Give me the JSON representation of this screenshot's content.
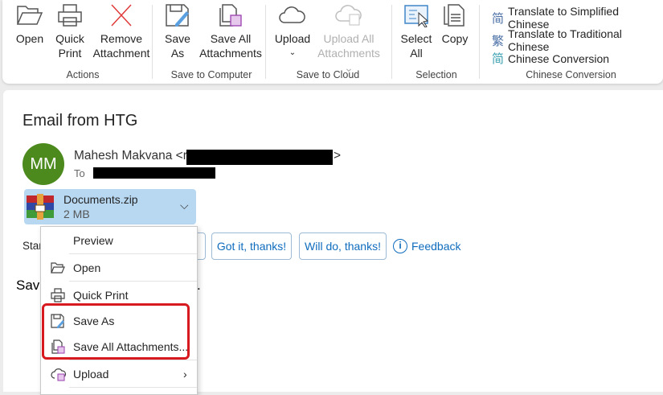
{
  "ribbon": {
    "open": "Open",
    "quick_print_1": "Quick",
    "quick_print_2": "Print",
    "remove_1": "Remove",
    "remove_2": "Attachment",
    "save_as_1": "Save",
    "save_as_2": "As",
    "save_all_1": "Save All",
    "save_all_2": "Attachments",
    "upload": "Upload",
    "upload_all_1": "Upload All",
    "upload_all_2": "Attachments",
    "select_all_1": "Select",
    "select_all_2": "All",
    "copy": "Copy",
    "translate_simplified": "Translate to Simplified Chinese",
    "translate_traditional": "Translate to Traditional Chinese",
    "chinese_conversion": "Chinese Conversion",
    "groups": [
      "Actions",
      "Save to Computer",
      "Save to Cloud",
      "Selection",
      "Chinese Conversion"
    ]
  },
  "email": {
    "subject": "Email from HTG",
    "avatar_initials": "MM",
    "sender_name": "Mahesh Makvana <r",
    "sender_end": ">",
    "to_label": "To",
    "attachment": {
      "name": "Documents.zip",
      "size": "2 MB"
    },
    "suggest_prefix": "Star",
    "replies": [
      "Got it, thanks!",
      "Will do, thanks!"
    ],
    "feedback": "Feedback",
    "body_fragment": "Save",
    "body_end": "."
  },
  "menu": {
    "preview": "Preview",
    "open": "Open",
    "quick_print": "Quick Print",
    "save_as": "Save As",
    "save_all": "Save All Attachments...",
    "upload": "Upload"
  },
  "colors": {
    "avatar": "#4c8a1d",
    "chip": "#b8d8f2",
    "highlight": "#d71920",
    "link": "#0f6cbd"
  }
}
